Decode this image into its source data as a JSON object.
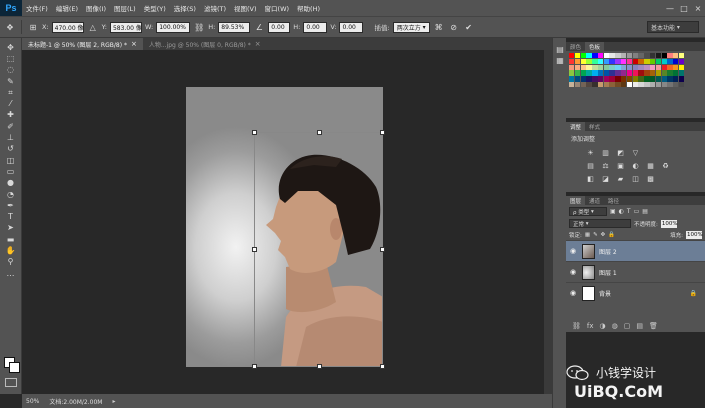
{
  "app": {
    "logo": "Ps"
  },
  "menu": [
    "文件(F)",
    "编辑(E)",
    "图像(I)",
    "图层(L)",
    "类型(Y)",
    "选择(S)",
    "滤镜(T)",
    "视图(V)",
    "窗口(W)",
    "帮助(H)"
  ],
  "window_controls": [
    "—",
    "□",
    "×"
  ],
  "options": {
    "x_label": "X:",
    "x_value": "470.00 像",
    "y_label": "Y:",
    "y_value": "583.00 像",
    "w_label": "W:",
    "w_value": "100.00%",
    "h_label": "H:",
    "h_value": "89.53%",
    "rotate_value": "0.00",
    "hskew_label": "H:",
    "hskew_value": "0.00",
    "vskew_label": "V:",
    "vskew_value": "0.00",
    "interp_label": "插值:",
    "interp_value": "两次立方",
    "workspace": "基本功能"
  },
  "tabs": [
    {
      "label": "未标题-1 @ 50% (图层 2, RGB/8) *",
      "close": "×"
    },
    {
      "label": "人物...jpg @ 50% (图层 0, RGB/8) *",
      "close": "×"
    }
  ],
  "status": {
    "zoom": "50%",
    "doc": "文档:2.00M/2.00M"
  },
  "swatches_panel": {
    "tabs": [
      "颜色",
      "色板"
    ]
  },
  "swatch_colors": [
    "#ff0000",
    "#ffff00",
    "#00ff00",
    "#00ffff",
    "#0000ff",
    "#ff00ff",
    "#ffffff",
    "#e6e6e6",
    "#cccccc",
    "#b3b3b3",
    "#999999",
    "#808080",
    "#666666",
    "#4d4d4d",
    "#333333",
    "#1a1a1a",
    "#000000",
    "#ff7f7f",
    "#ffbf7f",
    "#ffff7f",
    "#ff3333",
    "#ff9933",
    "#ffff33",
    "#99ff33",
    "#33ff99",
    "#33ffff",
    "#3399ff",
    "#3333ff",
    "#9933ff",
    "#ff33ff",
    "#ff3399",
    "#cc0000",
    "#cc6600",
    "#cccc00",
    "#66cc00",
    "#00cc66",
    "#00cccc",
    "#0066cc",
    "#0000cc",
    "#6600cc",
    "#f7977a",
    "#f9ad81",
    "#fdc68a",
    "#fff79a",
    "#c4df9b",
    "#a2d39c",
    "#82ca9d",
    "#7bcdc8",
    "#6ecff6",
    "#7ea7d8",
    "#8493ca",
    "#8882be",
    "#a187be",
    "#bc8dbf",
    "#f49ac2",
    "#f6989d",
    "#ed1c24",
    "#f26522",
    "#f7941d",
    "#fff200",
    "#8dc73f",
    "#39b54a",
    "#00a651",
    "#00a99d",
    "#00aeef",
    "#0072bc",
    "#0054a6",
    "#2e3192",
    "#662d91",
    "#92278f",
    "#ec008c",
    "#ed145b",
    "#9e0b0f",
    "#a0410d",
    "#a3620a",
    "#aba000",
    "#598527",
    "#197b30",
    "#007236",
    "#00746b",
    "#0076a3",
    "#004b80",
    "#003471",
    "#1b1464",
    "#440e62",
    "#630460",
    "#9e005d",
    "#9e0039",
    "#790000",
    "#7b2e00",
    "#7d4900",
    "#827b00",
    "#406618",
    "#005e20",
    "#005826",
    "#005952",
    "#005b7f",
    "#003663",
    "#002157",
    "#0d004c",
    "#c7b299",
    "#998675",
    "#736357",
    "#534741",
    "#37302d",
    "#c69c6d",
    "#a67c52",
    "#8c6239",
    "#754c24",
    "#603913",
    "#ffffff",
    "#ebebeb",
    "#d7d7d7",
    "#c3c3c3",
    "#afafaf",
    "#9b9b9b",
    "#878787",
    "#737373",
    "#5f5f5f",
    "#4b4b4b"
  ],
  "adjustments": {
    "tabs": [
      "调整",
      "样式"
    ],
    "title": "添加调整",
    "row1": [
      "☀",
      "▥",
      "◩",
      "▽"
    ],
    "row2": [
      "▤",
      "⚖",
      "▣",
      "◐",
      "▦",
      "♻"
    ],
    "row3": [
      "◧",
      "◪",
      "▰",
      "◫",
      "▩"
    ]
  },
  "layers": {
    "tabs": [
      "图层",
      "通道",
      "路径"
    ],
    "filter_label": "ρ 类型",
    "blend_mode": "正常",
    "opacity_label": "不透明度:",
    "opacity_value": "100%",
    "lock_label": "锁定:",
    "fill_label": "填充:",
    "fill_value": "100%",
    "items": [
      {
        "name": "图层 2",
        "eye": "◉",
        "selected": true
      },
      {
        "name": "图层 1",
        "eye": "◉",
        "selected": false
      },
      {
        "name": "背景",
        "eye": "◉",
        "selected": false,
        "lock": "🔒"
      }
    ],
    "bottom_icons": [
      "⛓",
      "fx",
      "◑",
      "◍",
      "▢",
      "▤",
      "🗑"
    ]
  },
  "watermark": {
    "text": "小钱学设计",
    "url": "UiBQ.CoM"
  }
}
